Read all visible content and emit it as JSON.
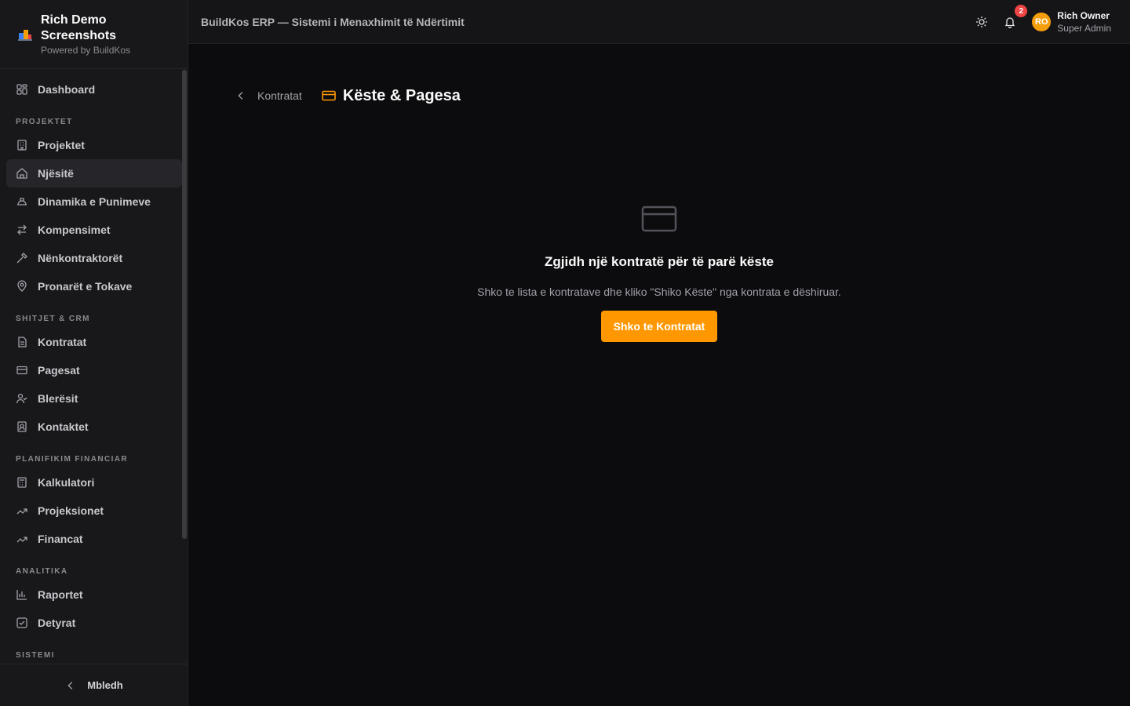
{
  "brand": {
    "name": "Rich Demo Screenshots",
    "powered": "Powered by BuildKos"
  },
  "header": {
    "title": "BuildKos ERP — Sistemi i Menaxhimit të Ndërtimit",
    "notifications": "2"
  },
  "user": {
    "initials": "RO",
    "name": "Rich Owner",
    "role": "Super Admin"
  },
  "sidebar": {
    "dashboard": "Dashboard",
    "sections": [
      "PROJEKTET",
      "SHITJET & CRM",
      "PLANIFIKIM FINANCIAR",
      "ANALITIKA",
      "SISTEMI"
    ],
    "items": [
      {
        "label": "Projektet",
        "icon": "building-icon"
      },
      {
        "label": "Njësitë",
        "icon": "home-icon",
        "active": true
      },
      {
        "label": "Dinamika e Punimeve",
        "icon": "hardhat-icon"
      },
      {
        "label": "Kompensimet",
        "icon": "swap-icon"
      },
      {
        "label": "Nënkontraktorët",
        "icon": "hammer-icon"
      },
      {
        "label": "Pronarët e Tokave",
        "icon": "map-pin-icon"
      },
      {
        "label": "Kontratat",
        "icon": "document-icon"
      },
      {
        "label": "Pagesat",
        "icon": "credit-card-icon"
      },
      {
        "label": "Blerësit",
        "icon": "user-check-icon"
      },
      {
        "label": "Kontaktet",
        "icon": "contact-icon"
      },
      {
        "label": "Kalkulatori",
        "icon": "calculator-icon"
      },
      {
        "label": "Projeksionet",
        "icon": "trending-up-icon"
      },
      {
        "label": "Financat",
        "icon": "trending-up-icon"
      },
      {
        "label": "Raportet",
        "icon": "bar-chart-icon"
      },
      {
        "label": "Detyrat",
        "icon": "checkbox-icon"
      }
    ],
    "collapse": "Mbledh"
  },
  "page": {
    "back": "Kontratat",
    "title": "Këste & Pagesa",
    "empty_title": "Zgjidh një kontratë për të parë këste",
    "empty_desc": "Shko te lista e kontratave dhe kliko \"Shiko Këste\" nga kontrata e dëshiruar.",
    "cta": "Shko te Kontratat"
  },
  "colors": {
    "accent": "#ff9800",
    "badge": "#ef4444",
    "avatar": "#f59e0b"
  }
}
